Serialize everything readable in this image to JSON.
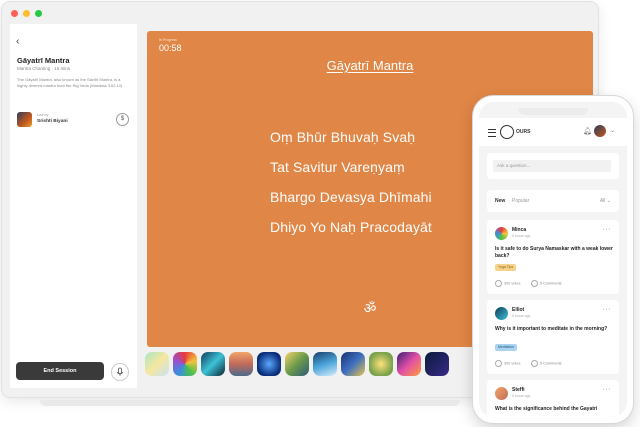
{
  "window": {
    "dot_colors": [
      "#ff5f57",
      "#febc2e",
      "#28c840"
    ]
  },
  "sidebar": {
    "back_icon": "chevron-left-icon",
    "title": "Gāyatrī Mantra",
    "subtitle": "Mantra Chanting · 15 mins",
    "description": "The Gāyatrī Mantra, also known as the Sāvitrī Mantra, is a highly revered mantra from the Rig Veda (Mandala 3.62.10).",
    "leader": {
      "led_by": "Led by",
      "name": "Srishti Biyani"
    },
    "coin_icon": "dollar-coin-icon",
    "end_button": "End Session",
    "mic_icon": "microphone-icon"
  },
  "stage": {
    "bg_color": "#e08646",
    "progress_label": "In Progress",
    "timer": "00:58",
    "title": "Gāyatrī Mantra",
    "lines": [
      "Oṃ Bhūr Bhuvaḥ Svaḥ",
      "Tat Savitur Vareṇyaṃ",
      "Bhargo Devasya Dhīmahi",
      "Dhiyo Yo Naḥ Pracodayāt"
    ],
    "om_symbol": "ॐ"
  },
  "thumbnails": [
    "gradient-pastel",
    "rainbow-swirl",
    "blue-crystal",
    "sunset-landscape",
    "blue-abstract",
    "fantasy-forest",
    "ocean-wave",
    "starry-night",
    "golden-portrait",
    "purple-cosmic",
    "deep-space"
  ],
  "phone": {
    "brand": "OURS",
    "search_placeholder": "Ask a question...",
    "tabs": {
      "new": "New",
      "popular": "Popular",
      "filter": "All"
    },
    "posts": [
      {
        "name": "Minca",
        "time": "5 hours ago",
        "question": "Is it safe to do Surya Namaskar with a weak lower back?",
        "tag": "Yoga Tips",
        "tag_color": "#f6d28a",
        "votes": "300 votes",
        "comments": "5 Comments"
      },
      {
        "name": "Elliot",
        "time": "5 hours ago",
        "question": "Why is it important to meditate in the morning?",
        "tag": "Meditation",
        "tag_color": "#a9d3ef",
        "votes": "300 votes",
        "comments": "5 Comments"
      },
      {
        "name": "Steffi",
        "time": "5 hours ago",
        "question": "What is the significance behind the Gayatri"
      }
    ]
  }
}
